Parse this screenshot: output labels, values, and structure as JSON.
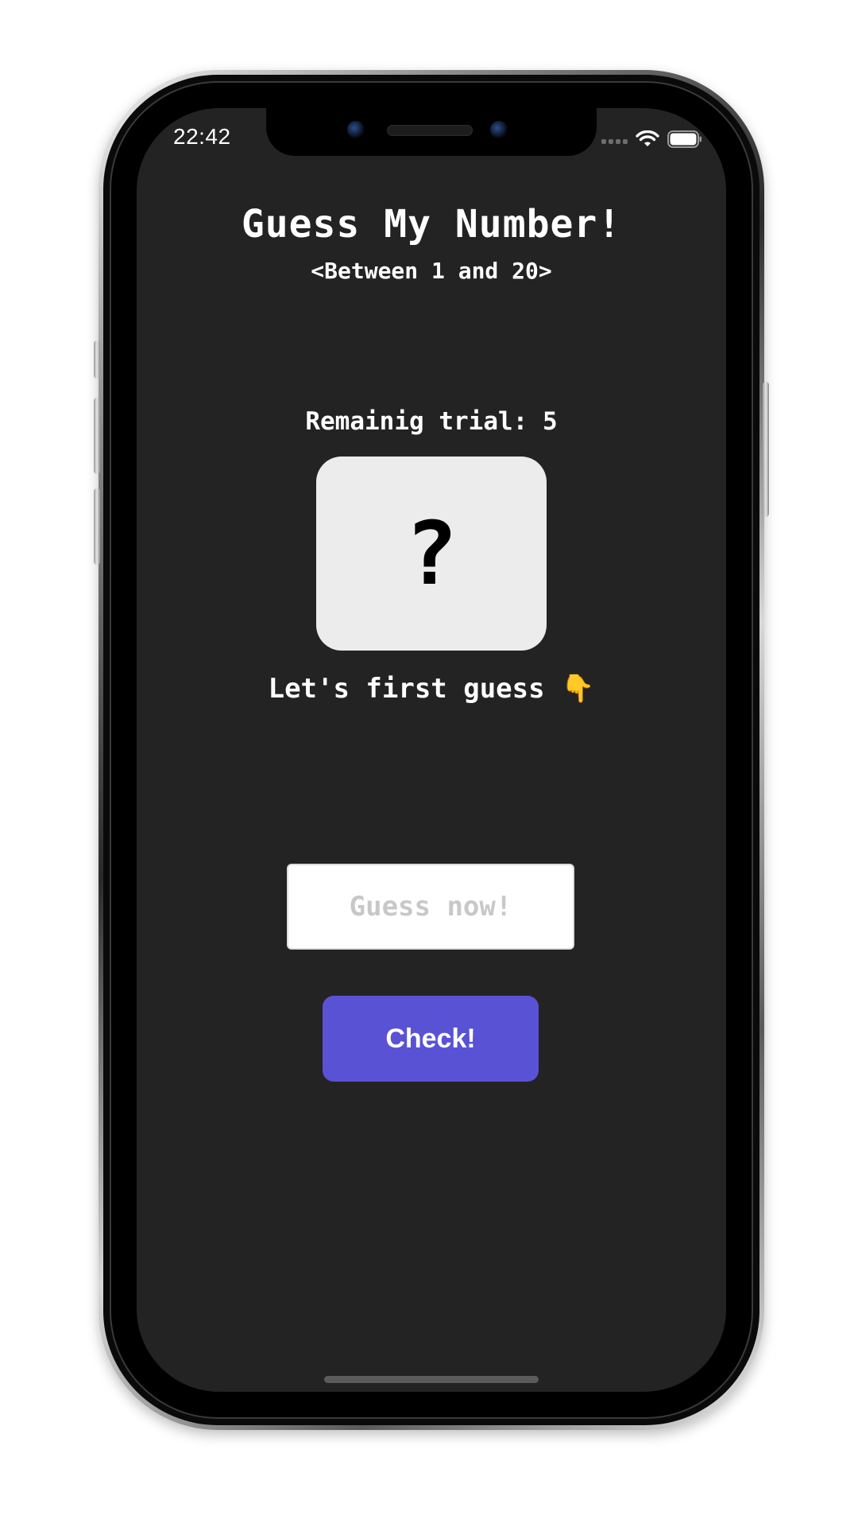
{
  "status_bar": {
    "time": "22:42"
  },
  "game": {
    "title": "Guess My Number!",
    "subtitle": "<Between 1 and 20>",
    "trials_text": "Remainig trial: 5",
    "mystery_number": "?",
    "hint": "Let's first guess 👇"
  },
  "guess_input": {
    "value": "",
    "placeholder": "Guess now!"
  },
  "check_button": {
    "label": "Check!"
  },
  "colors": {
    "background": "#232323",
    "number_box": "#ececec",
    "button": "#5a52d5"
  },
  "icons": {
    "wifi": "wifi-icon",
    "battery": "battery-icon",
    "signal": "signal-icon"
  }
}
